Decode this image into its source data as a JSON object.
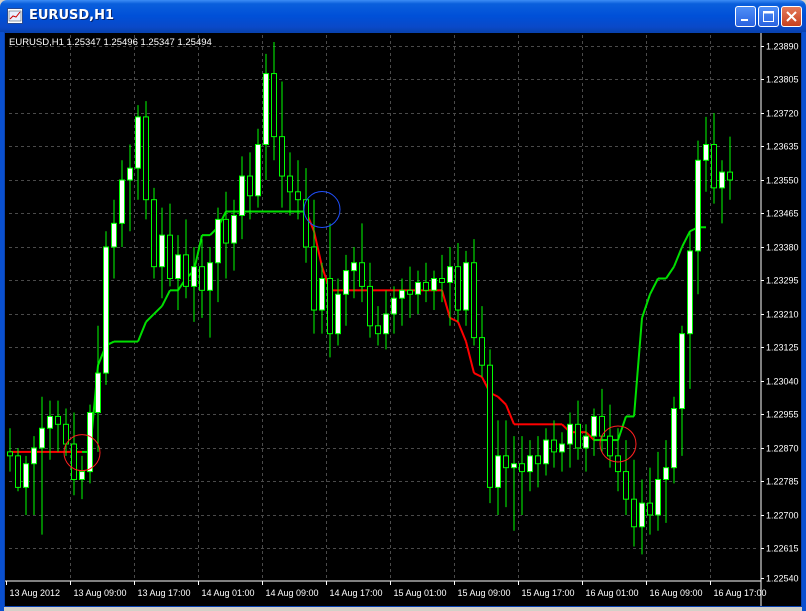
{
  "window": {
    "title": "EURUSD,H1",
    "icons": {
      "app": "chart-window-icon",
      "minimize": "minimize-icon",
      "maximize": "maximize-icon",
      "close": "close-icon"
    }
  },
  "header_info": "EURUSD,H1  1.25347 1.25496 1.25347 1.25494",
  "colors": {
    "background": "#000000",
    "grid": "#4a4a4a",
    "axis_text": "#ffffff",
    "candle_bull_body": "#ffffff",
    "candle_bear_body": "#000000",
    "candle_wick": "#00ff00",
    "indicator_up": "#00e000",
    "indicator_down": "#ff0000",
    "circle_red": "#ff2020",
    "circle_blue": "#2050ff"
  },
  "chart_data": {
    "type": "candlestick",
    "symbol": "EURUSD",
    "timeframe": "H1",
    "ylim": [
      1.2254,
      1.2393
    ],
    "y_ticks": [
      "1.23890",
      "1.23805",
      "1.23720",
      "1.23635",
      "1.23550",
      "1.23465",
      "1.23380",
      "1.23295",
      "1.23210",
      "1.23125",
      "1.23040",
      "1.22955",
      "1.22870",
      "1.22785",
      "1.22700",
      "1.22615",
      "1.22540"
    ],
    "x_ticks": [
      {
        "index": 0,
        "label": "13 Aug 2012"
      },
      {
        "index": 8,
        "label": "13 Aug 09:00"
      },
      {
        "index": 16,
        "label": "13 Aug 17:00"
      },
      {
        "index": 24,
        "label": "14 Aug 01:00"
      },
      {
        "index": 32,
        "label": "14 Aug 09:00"
      },
      {
        "index": 40,
        "label": "14 Aug 17:00"
      },
      {
        "index": 48,
        "label": "15 Aug 01:00"
      },
      {
        "index": 56,
        "label": "15 Aug 09:00"
      },
      {
        "index": 64,
        "label": "15 Aug 17:00"
      },
      {
        "index": 72,
        "label": "16 Aug 01:00"
      },
      {
        "index": 80,
        "label": "16 Aug 09:00"
      },
      {
        "index": 88,
        "label": "16 Aug 17:00"
      }
    ],
    "ohlc": [
      [
        1.2286,
        1.2292,
        1.2281,
        1.2285
      ],
      [
        1.2285,
        1.2287,
        1.2276,
        1.2277
      ],
      [
        1.2277,
        1.2285,
        1.227,
        1.2283
      ],
      [
        1.2283,
        1.229,
        1.227,
        1.2287
      ],
      [
        1.2287,
        1.23,
        1.2265,
        1.2292
      ],
      [
        1.2292,
        1.2299,
        1.2284,
        1.2295
      ],
      [
        1.2295,
        1.2299,
        1.2286,
        1.2293
      ],
      [
        1.2293,
        1.2297,
        1.2285,
        1.2288
      ],
      [
        1.2288,
        1.2296,
        1.2275,
        1.2279
      ],
      [
        1.2279,
        1.2285,
        1.2274,
        1.2281
      ],
      [
        1.2281,
        1.2298,
        1.2278,
        1.2296
      ],
      [
        1.2296,
        1.2318,
        1.2286,
        1.2306
      ],
      [
        1.2306,
        1.2342,
        1.2303,
        1.2338
      ],
      [
        1.2338,
        1.235,
        1.233,
        1.2344
      ],
      [
        1.2344,
        1.236,
        1.2338,
        1.2355
      ],
      [
        1.2355,
        1.2364,
        1.2342,
        1.2358
      ],
      [
        1.2358,
        1.2374,
        1.235,
        1.2371
      ],
      [
        1.2371,
        1.2375,
        1.2345,
        1.235
      ],
      [
        1.235,
        1.2353,
        1.233,
        1.2333
      ],
      [
        1.2333,
        1.2348,
        1.2325,
        1.2341
      ],
      [
        1.2341,
        1.2349,
        1.2328,
        1.233
      ],
      [
        1.233,
        1.2341,
        1.2322,
        1.2336
      ],
      [
        1.2336,
        1.2345,
        1.2325,
        1.2328
      ],
      [
        1.2328,
        1.2338,
        1.2319,
        1.2333
      ],
      [
        1.2333,
        1.234,
        1.232,
        1.2327
      ],
      [
        1.2327,
        1.2338,
        1.2315,
        1.2334
      ],
      [
        1.2334,
        1.2348,
        1.2324,
        1.2345
      ],
      [
        1.2345,
        1.2352,
        1.233,
        1.2339
      ],
      [
        1.2339,
        1.235,
        1.2332,
        1.2346
      ],
      [
        1.2346,
        1.2361,
        1.234,
        1.2356
      ],
      [
        1.2356,
        1.2362,
        1.2345,
        1.2351
      ],
      [
        1.2351,
        1.2368,
        1.2348,
        1.2364
      ],
      [
        1.2364,
        1.2387,
        1.2355,
        1.2382
      ],
      [
        1.2382,
        1.239,
        1.236,
        1.2366
      ],
      [
        1.2366,
        1.238,
        1.2348,
        1.2356
      ],
      [
        1.2356,
        1.2362,
        1.2346,
        1.2352
      ],
      [
        1.2352,
        1.236,
        1.2345,
        1.235
      ],
      [
        1.235,
        1.2358,
        1.2334,
        1.2338
      ],
      [
        1.2338,
        1.235,
        1.2316,
        1.2322
      ],
      [
        1.2322,
        1.2334,
        1.2316,
        1.233
      ],
      [
        1.233,
        1.2344,
        1.231,
        1.2316
      ],
      [
        1.2316,
        1.233,
        1.2313,
        1.2326
      ],
      [
        1.2326,
        1.2336,
        1.2318,
        1.2332
      ],
      [
        1.2332,
        1.2338,
        1.2325,
        1.2334
      ],
      [
        1.2334,
        1.2344,
        1.2324,
        1.2328
      ],
      [
        1.2328,
        1.2334,
        1.2315,
        1.2318
      ],
      [
        1.2318,
        1.2323,
        1.2313,
        1.2316
      ],
      [
        1.2316,
        1.2327,
        1.2312,
        1.2321
      ],
      [
        1.2321,
        1.2328,
        1.2316,
        1.2325
      ],
      [
        1.2325,
        1.233,
        1.2318,
        1.2327
      ],
      [
        1.2327,
        1.2333,
        1.232,
        1.2326
      ],
      [
        1.2326,
        1.2332,
        1.2321,
        1.2329
      ],
      [
        1.2329,
        1.2334,
        1.2324,
        1.2327
      ],
      [
        1.2327,
        1.2332,
        1.2322,
        1.233
      ],
      [
        1.233,
        1.2336,
        1.2324,
        1.2329
      ],
      [
        1.2329,
        1.2338,
        1.2318,
        1.2333
      ],
      [
        1.2333,
        1.2339,
        1.2319,
        1.2322
      ],
      [
        1.2322,
        1.2337,
        1.2318,
        1.2334
      ],
      [
        1.2334,
        1.234,
        1.2313,
        1.2315
      ],
      [
        1.2315,
        1.2323,
        1.2305,
        1.2308
      ],
      [
        1.2308,
        1.2312,
        1.2273,
        1.2277
      ],
      [
        1.2277,
        1.2294,
        1.227,
        1.2285
      ],
      [
        1.2285,
        1.2294,
        1.2272,
        1.2282
      ],
      [
        1.2282,
        1.229,
        1.2266,
        1.2283
      ],
      [
        1.2283,
        1.229,
        1.227,
        1.2281
      ],
      [
        1.2281,
        1.2289,
        1.2276,
        1.2285
      ],
      [
        1.2285,
        1.229,
        1.2277,
        1.2283
      ],
      [
        1.2283,
        1.2292,
        1.228,
        1.2289
      ],
      [
        1.2289,
        1.2294,
        1.2282,
        1.2286
      ],
      [
        1.2286,
        1.2291,
        1.2281,
        1.2288
      ],
      [
        1.2288,
        1.2296,
        1.2282,
        1.2293
      ],
      [
        1.2293,
        1.2299,
        1.2284,
        1.2287
      ],
      [
        1.2287,
        1.2293,
        1.2281,
        1.229
      ],
      [
        1.229,
        1.2297,
        1.2285,
        1.2295
      ],
      [
        1.2295,
        1.2302,
        1.2286,
        1.229
      ],
      [
        1.229,
        1.2298,
        1.2282,
        1.2285
      ],
      [
        1.2285,
        1.2292,
        1.2276,
        1.2281
      ],
      [
        1.2281,
        1.2289,
        1.227,
        1.2274
      ],
      [
        1.2274,
        1.2284,
        1.2262,
        1.2267
      ],
      [
        1.2267,
        1.2279,
        1.226,
        1.2273
      ],
      [
        1.2273,
        1.2282,
        1.2265,
        1.227
      ],
      [
        1.227,
        1.2286,
        1.2266,
        1.2279
      ],
      [
        1.2279,
        1.2289,
        1.2268,
        1.2282
      ],
      [
        1.2282,
        1.23,
        1.2278,
        1.2297
      ],
      [
        1.2297,
        1.2318,
        1.2285,
        1.2316
      ],
      [
        1.2316,
        1.2342,
        1.2302,
        1.2337
      ],
      [
        1.2337,
        1.2365,
        1.2326,
        1.236
      ],
      [
        1.236,
        1.2371,
        1.2352,
        1.2364
      ],
      [
        1.2364,
        1.2372,
        1.2349,
        1.2353
      ],
      [
        1.2353,
        1.236,
        1.2344,
        1.2357
      ],
      [
        1.2357,
        1.2366,
        1.235,
        1.2355
      ]
    ],
    "indicator": {
      "name": "trailing stop",
      "values": [
        1.2286,
        1.2286,
        1.2286,
        1.2286,
        1.2286,
        1.2286,
        1.2286,
        1.2286,
        1.2286,
        1.2286,
        1.2286,
        1.2308,
        1.2313,
        1.2314,
        1.2314,
        1.2314,
        1.2314,
        1.2319,
        1.2321,
        1.2323,
        1.2327,
        1.2327,
        1.233,
        1.2332,
        1.2341,
        1.2341,
        1.2343,
        1.2347,
        1.2347,
        1.2347,
        1.2347,
        1.2347,
        1.2347,
        1.2347,
        1.2347,
        1.2347,
        1.2347,
        1.2347,
        1.2342,
        1.2333,
        1.2327,
        1.2327,
        1.2327,
        1.2327,
        1.2327,
        1.2327,
        1.2327,
        1.2327,
        1.2327,
        1.2327,
        1.2327,
        1.2327,
        1.2327,
        1.2327,
        1.2327,
        1.232,
        1.2319,
        1.2314,
        1.2306,
        1.2305,
        1.2301,
        1.23,
        1.2298,
        1.2293,
        1.2293,
        1.2293,
        1.2293,
        1.2293,
        1.2293,
        1.2293,
        1.2291,
        1.2291,
        1.2291,
        1.2289,
        1.2289,
        1.2289,
        1.2289,
        1.2295,
        1.2295,
        1.232,
        1.2326,
        1.233,
        1.233,
        1.2333,
        1.2338,
        1.2342,
        1.2343,
        1.2343
      ],
      "colors": [
        "red",
        "red",
        "red",
        "red",
        "red",
        "red",
        "red",
        "red",
        "red",
        "red",
        "green",
        "green",
        "green",
        "green",
        "green",
        "green",
        "green",
        "green",
        "green",
        "green",
        "green",
        "green",
        "green",
        "green",
        "green",
        "green",
        "green",
        "green",
        "green",
        "green",
        "green",
        "green",
        "green",
        "green",
        "green",
        "green",
        "green",
        "green",
        "red",
        "red",
        "red",
        "red",
        "red",
        "red",
        "red",
        "red",
        "red",
        "red",
        "red",
        "red",
        "red",
        "red",
        "red",
        "red",
        "red",
        "red",
        "red",
        "red",
        "red",
        "red",
        "red",
        "red",
        "red",
        "red",
        "red",
        "red",
        "red",
        "red",
        "red",
        "red",
        "red",
        "red",
        "red",
        "red",
        "green",
        "green",
        "green",
        "green",
        "green",
        "green",
        "green",
        "green",
        "green",
        "green",
        "green",
        "green",
        "green",
        "green"
      ]
    },
    "annotations": [
      {
        "shape": "circle",
        "color": "red",
        "index": 9,
        "price": 1.22858
      },
      {
        "shape": "circle",
        "color": "blue",
        "index": 39,
        "price": 1.23475
      },
      {
        "shape": "circle",
        "color": "red",
        "index": 76,
        "price": 1.2288
      }
    ],
    "grid": true
  }
}
